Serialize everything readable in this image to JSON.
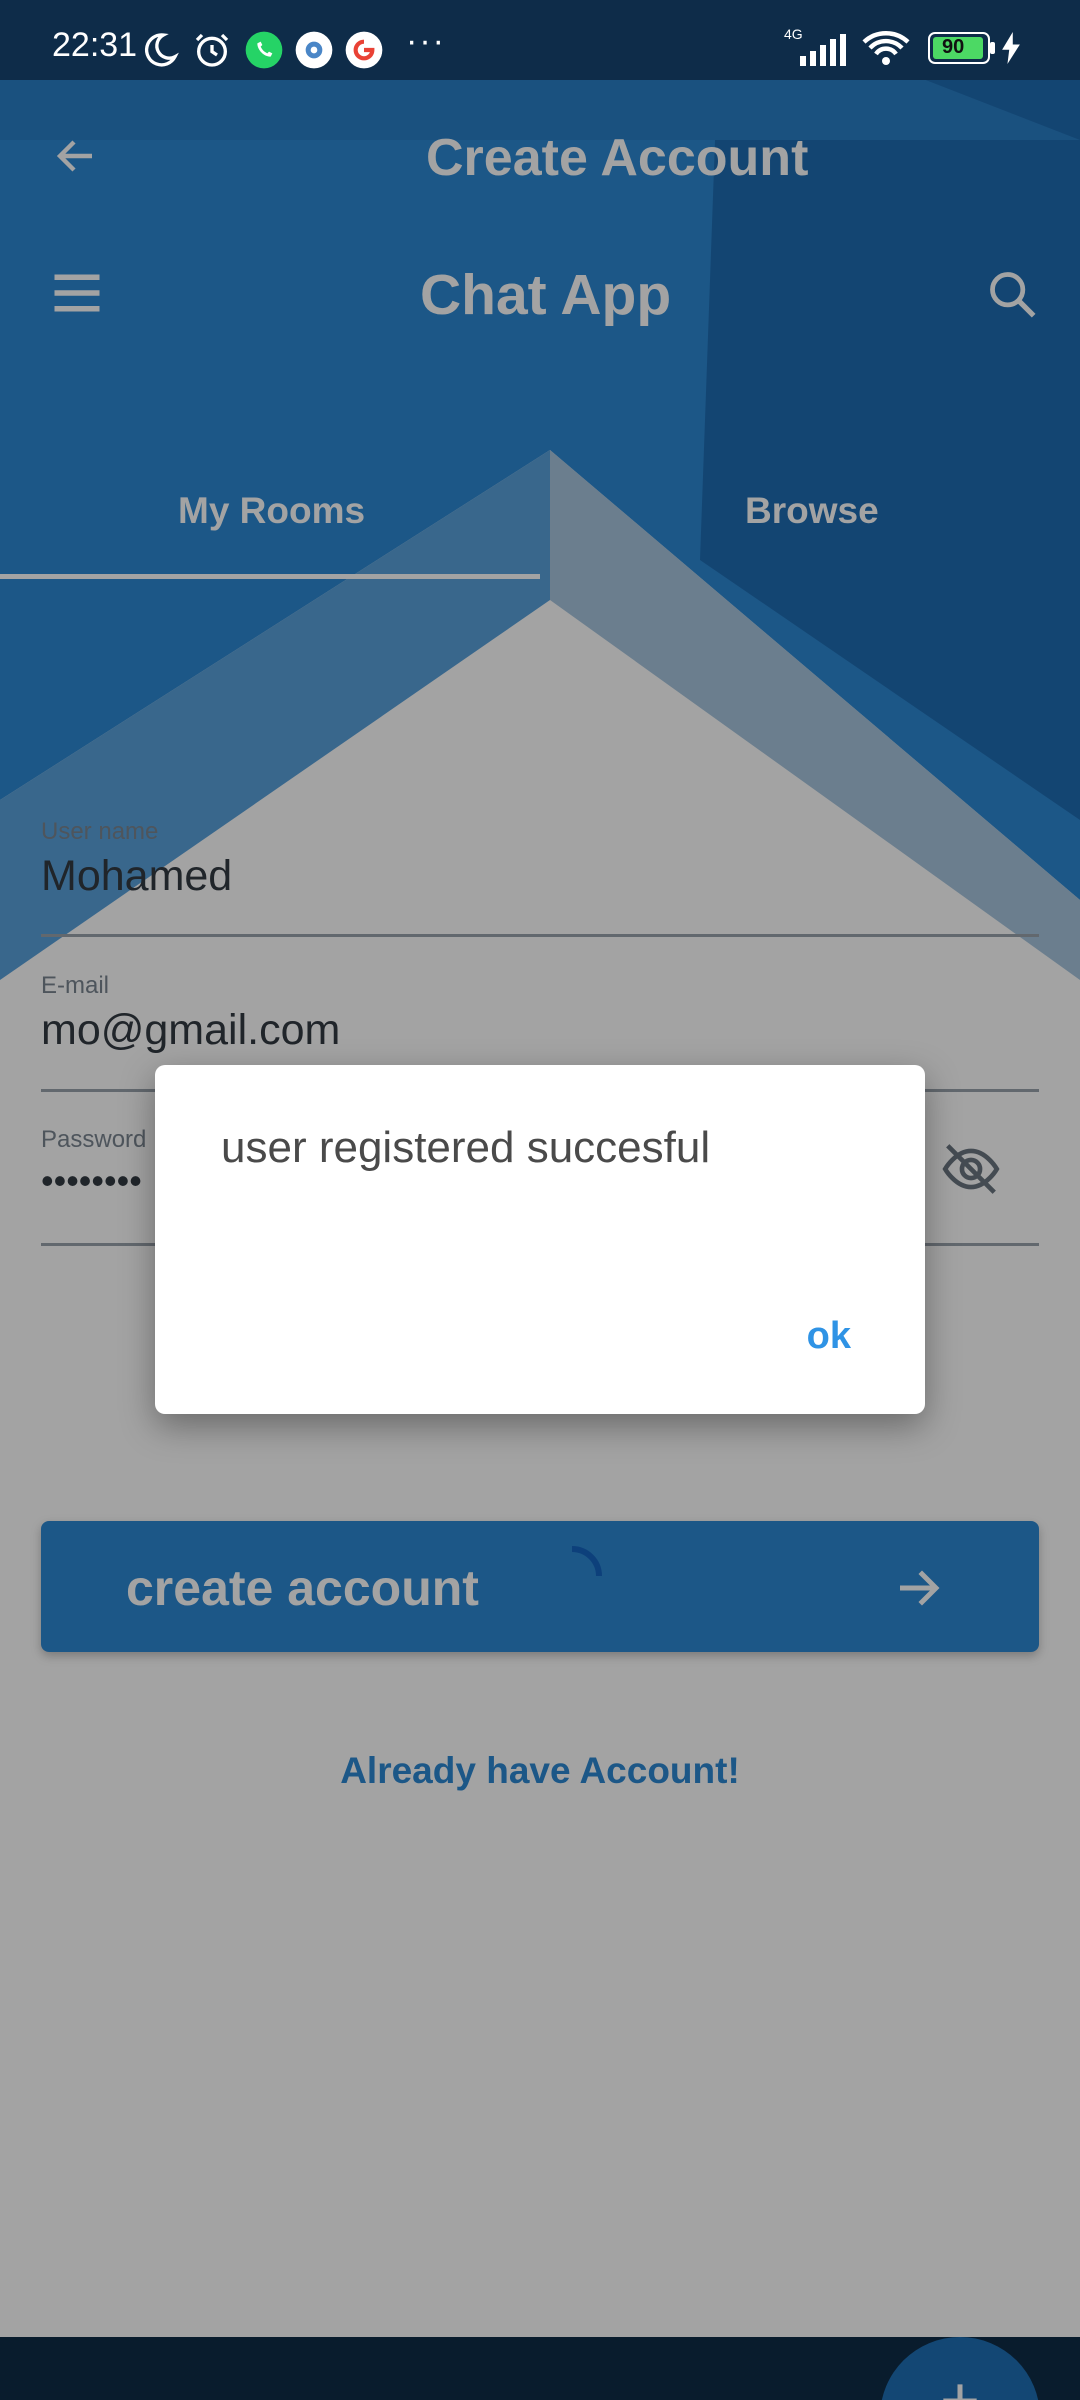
{
  "status_bar": {
    "time": "22:31",
    "network": "4G",
    "battery": "90",
    "more": "···"
  },
  "app_bar": {
    "title": "Create Account",
    "app_title": "Chat App"
  },
  "tabs": [
    {
      "label": "My Rooms",
      "selected": true
    },
    {
      "label": "Browse",
      "selected": false
    }
  ],
  "form": {
    "username": {
      "label": "User name",
      "value": "Mohamed"
    },
    "email": {
      "label": "E-mail",
      "value": "mo@gmail.com"
    },
    "password": {
      "label": "Password",
      "value": "••••••••"
    }
  },
  "create_button": {
    "label": "create account"
  },
  "login_link": "Already have Account!",
  "dialog": {
    "message": "user registered succesful",
    "ok_label": "ok"
  },
  "colors": {
    "primary": "#2d88d3",
    "primary_dark": "#0f2d47",
    "accent": "#2f93e5"
  }
}
